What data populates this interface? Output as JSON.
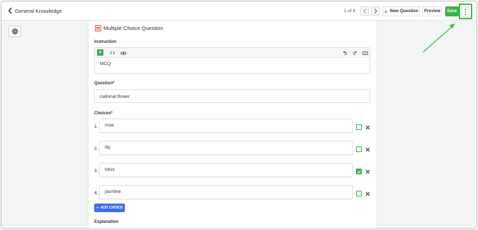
{
  "header": {
    "back_label": "General Knowledge",
    "pager": "1 of 8",
    "new_question_label": "New Question",
    "preview_label": "Preview",
    "save_label": "Save"
  },
  "question": {
    "type_label": "Multiple Choice Question",
    "instruction_label": "Instruction",
    "instruction_value": "MCQ",
    "question_label": "Question*",
    "question_value": "national flower",
    "choices_label": "Choices*",
    "choices": [
      {
        "num": "1.",
        "value": "rose",
        "checked": false
      },
      {
        "num": "2.",
        "value": "lily",
        "checked": false
      },
      {
        "num": "3.",
        "value": "lotus",
        "checked": true
      },
      {
        "num": "4.",
        "value": "jasmine",
        "checked": false
      }
    ],
    "add_choice_label": "ADD CHOICE",
    "explanation_label": "Explanation"
  },
  "colors": {
    "accent_green": "#3ab14a",
    "button_blue": "#3d6df2",
    "highlight_green": "#3cbf45",
    "type_icon_red": "#e05b5b"
  },
  "icons": [
    "chevron-left-icon",
    "chevron-right-icon",
    "gear-icon",
    "plus-icon",
    "code-icon",
    "link-icon",
    "undo-icon",
    "redo-icon",
    "keyboard-icon",
    "kebab-menu-icon",
    "close-icon",
    "check-icon",
    "list-icon",
    "annotation-arrow-icon"
  ]
}
